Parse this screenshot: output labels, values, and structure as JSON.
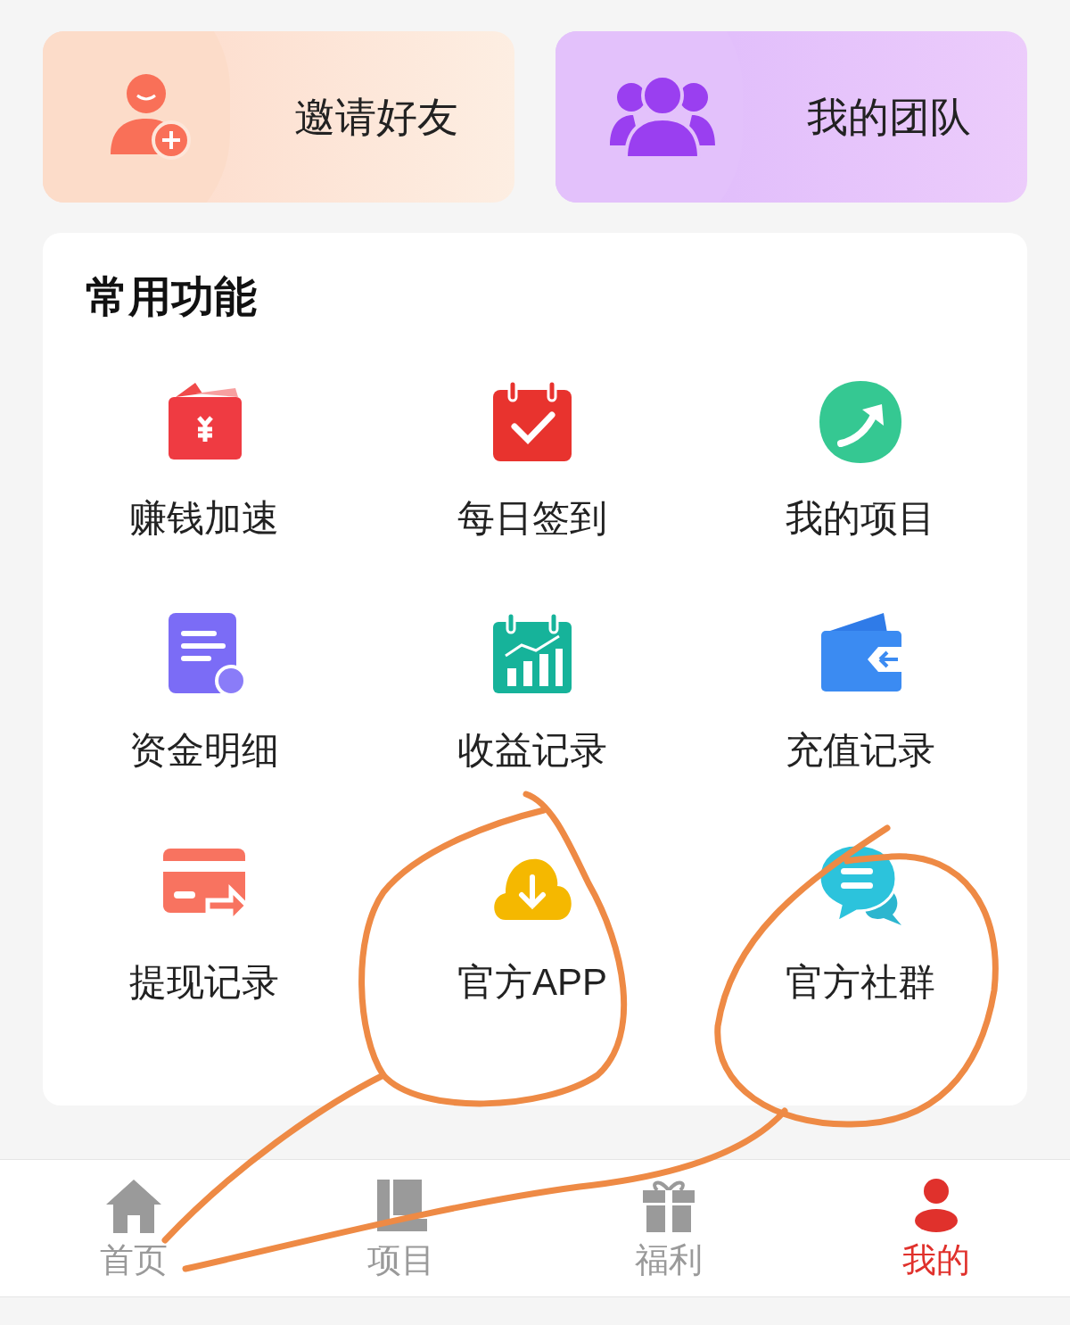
{
  "top_cards": [
    {
      "label": "邀请好友"
    },
    {
      "label": "我的团队"
    }
  ],
  "functions": {
    "title": "常用功能",
    "items": [
      {
        "label": "赚钱加速"
      },
      {
        "label": "每日签到"
      },
      {
        "label": "我的项目"
      },
      {
        "label": "资金明细"
      },
      {
        "label": "收益记录"
      },
      {
        "label": "充值记录"
      },
      {
        "label": "提现记录"
      },
      {
        "label": "官方APP"
      },
      {
        "label": "官方社群"
      }
    ]
  },
  "bottom_nav": [
    {
      "label": "首页",
      "selected": false
    },
    {
      "label": "项目",
      "selected": false
    },
    {
      "label": "福利",
      "selected": false
    },
    {
      "label": "我的",
      "selected": true
    }
  ]
}
